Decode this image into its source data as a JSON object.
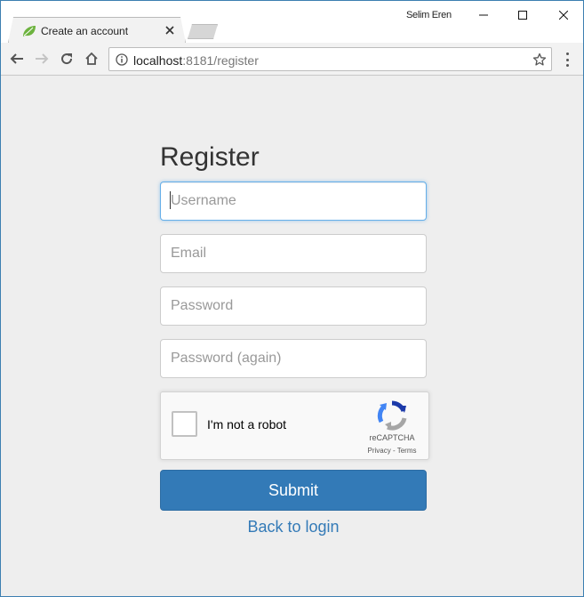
{
  "browser": {
    "tab_title": "Create an account",
    "profile_name": "Selim Eren",
    "url_host": "localhost",
    "url_rest": ":8181/register"
  },
  "icons": {
    "favicon": "spring-leaf-icon",
    "tab_close": "close-icon",
    "back": "arrow-left-icon",
    "forward": "arrow-right-icon",
    "reload": "reload-icon",
    "home": "home-icon",
    "site_info": "info-icon",
    "bookmark": "star-icon",
    "menu": "kebab-menu-icon",
    "recaptcha": "recaptcha-logo-icon"
  },
  "form": {
    "title": "Register",
    "username_placeholder": "Username",
    "email_placeholder": "Email",
    "password_placeholder": "Password",
    "password_again_placeholder": "Password (again)",
    "username_value": "",
    "email_value": "",
    "password_value": "",
    "password_again_value": ""
  },
  "captcha": {
    "label": "I'm not a robot",
    "brand": "reCAPTCHA",
    "links": "Privacy - Terms"
  },
  "actions": {
    "submit_label": "Submit",
    "back_label": "Back to login"
  },
  "colors": {
    "primary": "#337ab7",
    "page_background": "#eeeeee",
    "focus_border": "#66afe9"
  }
}
